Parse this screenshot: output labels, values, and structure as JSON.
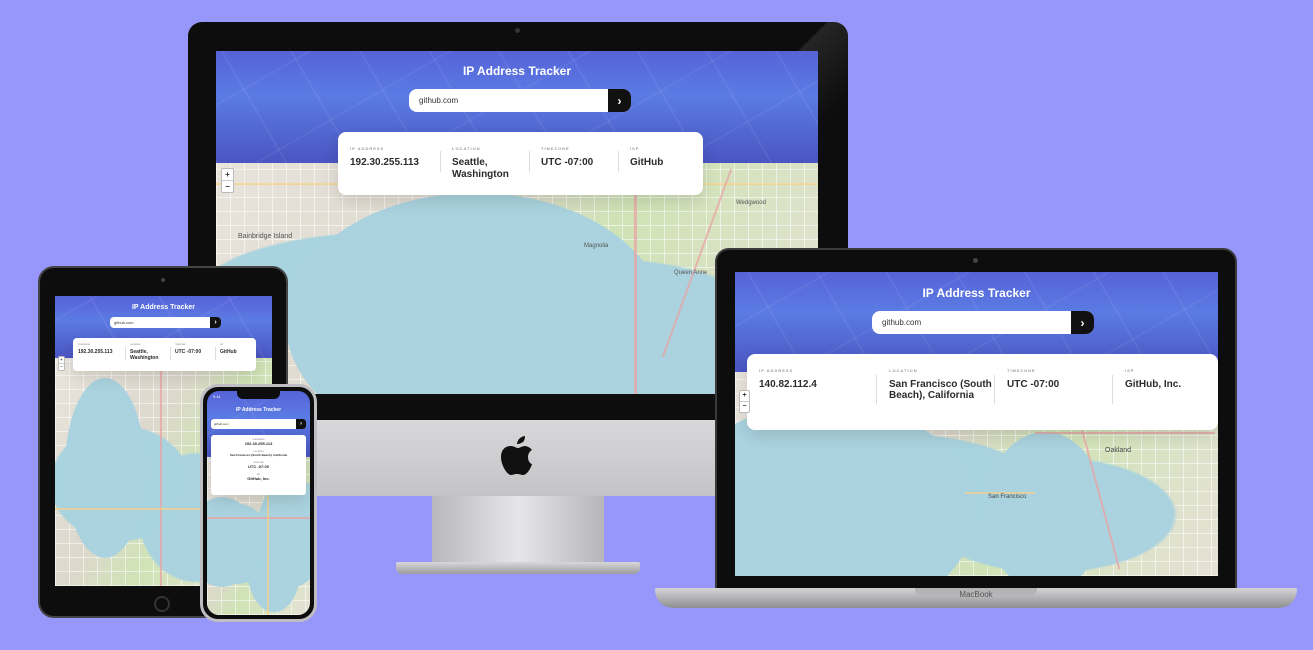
{
  "app": {
    "title": "IP Address Tracker",
    "labels": {
      "ip": "IP ADDRESS",
      "location": "LOCATION",
      "timezone": "TIMEZONE",
      "isp": "ISP"
    }
  },
  "imac": {
    "search_value": "github.com",
    "ip": "192.30.255.113",
    "location": "Seattle, Washington",
    "timezone": "UTC -07:00",
    "isp": "GitHub"
  },
  "macbook": {
    "search_value": "github.com",
    "ip": "140.82.112.4",
    "location": "San Francisco (South Beach), California",
    "timezone": "UTC -07:00",
    "isp": "GitHub, Inc.",
    "brand_label": "MacBook"
  },
  "ipad": {
    "search_value": "github.com",
    "ip": "192.30.255.113",
    "location": "Seattle, Washington",
    "timezone": "UTC -07:00",
    "isp": "GitHub"
  },
  "iphone": {
    "status_time": "9:41",
    "search_value": "github.com",
    "ip": "192.30.255.113",
    "location": "San Francisco (South Beach), California",
    "timezone": "UTC -07:00",
    "isp": "GitHub, Inc."
  },
  "map_labels": {
    "bainbridge_island": "Bainbridge Island",
    "magnolia": "Magnolia",
    "queen_anne": "Queen Anne",
    "wedgwood": "Wedgwood",
    "san_francisco": "San Francisco",
    "oakland": "Oakland"
  },
  "map_controls": {
    "zoom_in": "+",
    "zoom_out": "−"
  },
  "search_button_glyph": "›",
  "icons": [
    "apple-logo-icon",
    "chevron-right-icon"
  ],
  "colors": {
    "background": "#9797fb",
    "header": "#5b6ee0",
    "button": "#111111"
  }
}
